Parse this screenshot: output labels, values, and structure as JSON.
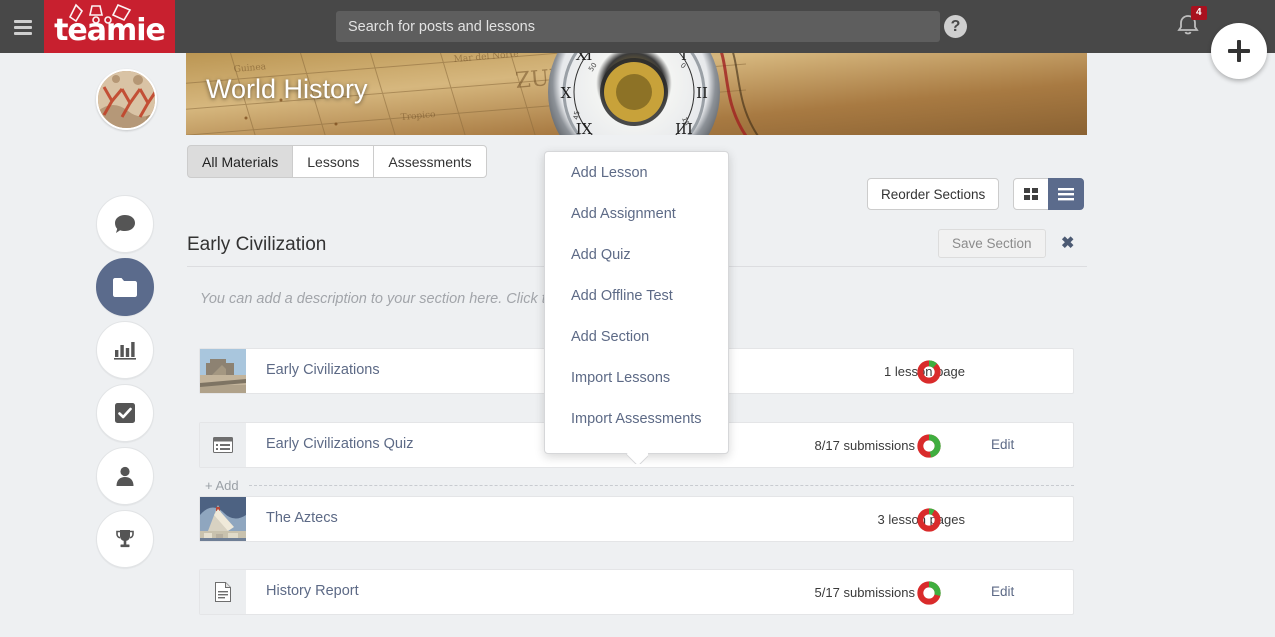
{
  "colors": {
    "brand_red": "#c8202f",
    "topbar": "#484848",
    "accent_blue": "#5b6b8c",
    "link": "#5d6a86",
    "progress_done": "#3fae3f",
    "progress_pending": "#d92b2b",
    "page_bg": "#eef0f2"
  },
  "topbar": {
    "menu_icon": "hamburger-icon",
    "logo_text": "teamie",
    "search": {
      "placeholder": "Search for posts and lessons",
      "value": ""
    },
    "help_icon": "?",
    "notification_icon": "notification-bell-icon",
    "notification_count": "4",
    "add_icon": "plus-icon"
  },
  "sidebar": {
    "avatar": "course-avatar",
    "items": [
      {
        "icon": "chat-bubble-icon",
        "name": "sidebar-item-social",
        "active": false
      },
      {
        "icon": "folder-icon",
        "name": "sidebar-item-materials",
        "active": true
      },
      {
        "icon": "bar-chart-icon",
        "name": "sidebar-item-analytics",
        "active": false
      },
      {
        "icon": "checkbox-icon",
        "name": "sidebar-item-tasks",
        "active": false
      },
      {
        "icon": "person-icon",
        "name": "sidebar-item-people",
        "active": false
      },
      {
        "icon": "trophy-icon",
        "name": "sidebar-item-badges",
        "active": false
      }
    ]
  },
  "banner": {
    "title": "World History"
  },
  "tabs": [
    {
      "label": "All Materials",
      "active": true
    },
    {
      "label": "Lessons",
      "active": false
    },
    {
      "label": "Assessments",
      "active": false
    }
  ],
  "toolbar": {
    "reorder_label": "Reorder Sections",
    "grid_view_icon": "grid-view-icon",
    "list_view_icon": "list-view-icon",
    "active_view": "list"
  },
  "section": {
    "title": "Early Civilization",
    "save_label": "Save Section",
    "close_icon": "close-icon",
    "description_placeholder": "You can add a description to your section here. Click to edit."
  },
  "add_divider": {
    "label": "+ Add"
  },
  "dropdown": {
    "items": [
      "Add Lesson",
      "Add Assignment",
      "Add Quiz",
      "Add Offline Test",
      "Add Section",
      "Import Lessons",
      "Import Assessments"
    ]
  },
  "rows": [
    {
      "title": "Early Civilizations",
      "meta": "1 lesson page",
      "thumb": "ruins-thumbnail",
      "icon": null,
      "edit": "",
      "progress_percent": 12
    },
    {
      "title": "Early Civilizations Quiz",
      "meta": "8/17 submissions",
      "thumb": null,
      "icon": "quiz-icon",
      "edit": "Edit",
      "progress_percent": 47
    },
    {
      "title": "The Aztecs",
      "meta": "3 lesson pages",
      "thumb": "aztec-pyramid-thumbnail",
      "icon": null,
      "edit": "",
      "progress_percent": 8
    },
    {
      "title": "History Report",
      "meta": "5/17 submissions",
      "thumb": null,
      "icon": "document-icon",
      "edit": "Edit",
      "progress_percent": 29
    }
  ]
}
